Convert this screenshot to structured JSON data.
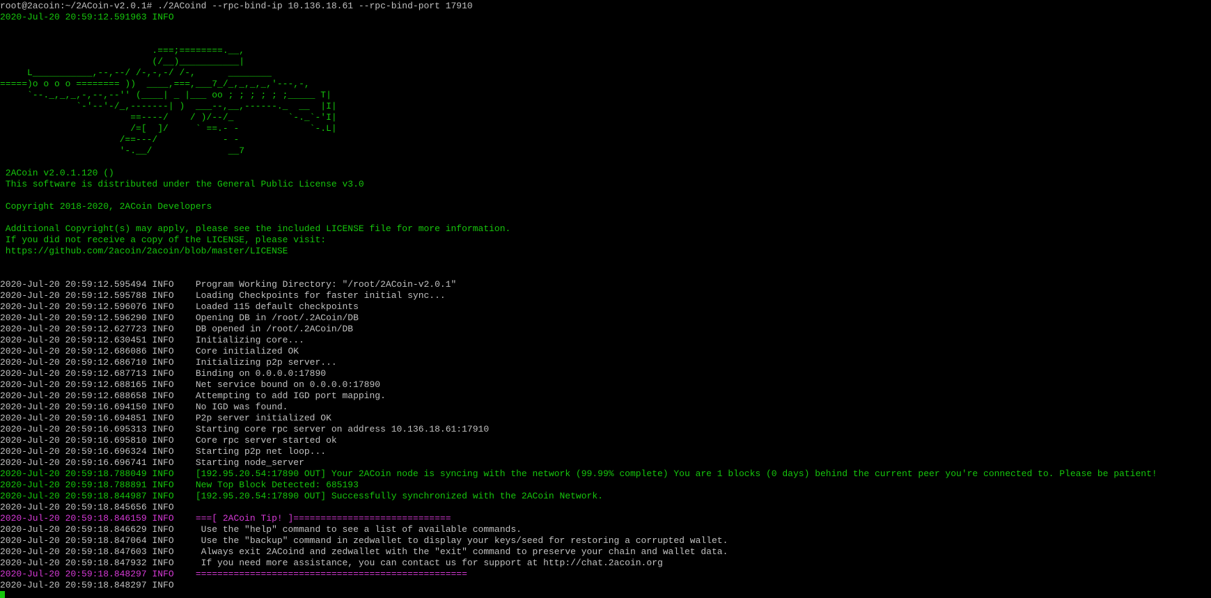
{
  "window": {
    "title": "root@2acoin:~/2ACoin-v2.0.1"
  },
  "colors": {
    "background": "#000000",
    "default_text": "#c0c0c0",
    "info_green": "#16c60c",
    "tip_magenta": "#d63ad6",
    "cursor": "#16c60c"
  },
  "terminal": {
    "lines": [
      {
        "text": "root@2acoin:~/2ACoin-v2.0.1# ./2ACoind --rpc-bind-ip 10.136.18.61 --rpc-bind-port 17910",
        "color": "white"
      },
      {
        "text": "2020-Jul-20 20:59:12.591963 INFO",
        "color": "green"
      },
      {
        "text": "",
        "color": "white"
      },
      {
        "text": "",
        "color": "white"
      },
      {
        "text": "                            .===;========.__,",
        "color": "green"
      },
      {
        "text": "                            (/__)___________|",
        "color": "green"
      },
      {
        "text": "     L___________,--,--/ /-,-,-/ /-,      ________",
        "color": "green"
      },
      {
        "text": "=====)o o o o ======== ))  ____,===,___7_/_,_,_,_,'---,-,",
        "color": "green"
      },
      {
        "text": "     `--._,_,_,-,--,--'' (____| _ |___ oo ; ; ; ; ; ;_____ T|",
        "color": "green"
      },
      {
        "text": "              `-'--'-/_,-------| )  ___--,__,------._  __  |I|",
        "color": "green"
      },
      {
        "text": "                        ==----/    / )/--/_          `-._`-'I|",
        "color": "green"
      },
      {
        "text": "                        /=[  ]/     ` ==.- -             `-.L|",
        "color": "green"
      },
      {
        "text": "                      /==---/            - -",
        "color": "green"
      },
      {
        "text": "                      '-.__/              __7",
        "color": "green"
      },
      {
        "text": "",
        "color": "white"
      },
      {
        "text": " 2ACoin v2.0.1.120 ()",
        "color": "green"
      },
      {
        "text": " This software is distributed under the General Public License v3.0",
        "color": "green"
      },
      {
        "text": "",
        "color": "white"
      },
      {
        "text": " Copyright 2018-2020, 2ACoin Developers",
        "color": "green"
      },
      {
        "text": "",
        "color": "white"
      },
      {
        "text": " Additional Copyright(s) may apply, please see the included LICENSE file for more information.",
        "color": "green"
      },
      {
        "text": " If you did not receive a copy of the LICENSE, please visit:",
        "color": "green"
      },
      {
        "text": " https://github.com/2acoin/2acoin/blob/master/LICENSE",
        "color": "green"
      },
      {
        "text": "",
        "color": "white"
      },
      {
        "text": "",
        "color": "white"
      },
      {
        "text": "2020-Jul-20 20:59:12.595494 INFO    Program Working Directory: \"/root/2ACoin-v2.0.1\"",
        "color": "white"
      },
      {
        "text": "2020-Jul-20 20:59:12.595788 INFO    Loading Checkpoints for faster initial sync...",
        "color": "white"
      },
      {
        "text": "2020-Jul-20 20:59:12.596076 INFO    Loaded 115 default checkpoints",
        "color": "white"
      },
      {
        "text": "2020-Jul-20 20:59:12.596290 INFO    Opening DB in /root/.2ACoin/DB",
        "color": "white"
      },
      {
        "text": "2020-Jul-20 20:59:12.627723 INFO    DB opened in /root/.2ACoin/DB",
        "color": "white"
      },
      {
        "text": "2020-Jul-20 20:59:12.630451 INFO    Initializing core...",
        "color": "white"
      },
      {
        "text": "2020-Jul-20 20:59:12.686086 INFO    Core initialized OK",
        "color": "white"
      },
      {
        "text": "2020-Jul-20 20:59:12.686710 INFO    Initializing p2p server...",
        "color": "white"
      },
      {
        "text": "2020-Jul-20 20:59:12.687713 INFO    Binding on 0.0.0.0:17890",
        "color": "white"
      },
      {
        "text": "2020-Jul-20 20:59:12.688165 INFO    Net service bound on 0.0.0.0:17890",
        "color": "white"
      },
      {
        "text": "2020-Jul-20 20:59:12.688658 INFO    Attempting to add IGD port mapping.",
        "color": "white"
      },
      {
        "text": "2020-Jul-20 20:59:16.694150 INFO    No IGD was found.",
        "color": "white"
      },
      {
        "text": "2020-Jul-20 20:59:16.694851 INFO    P2p server initialized OK",
        "color": "white"
      },
      {
        "text": "2020-Jul-20 20:59:16.695313 INFO    Starting core rpc server on address 10.136.18.61:17910",
        "color": "white"
      },
      {
        "text": "2020-Jul-20 20:59:16.695810 INFO    Core rpc server started ok",
        "color": "white"
      },
      {
        "text": "2020-Jul-20 20:59:16.696324 INFO    Starting p2p net loop...",
        "color": "white"
      },
      {
        "text": "2020-Jul-20 20:59:16.696741 INFO    Starting node_server",
        "color": "white"
      },
      {
        "text": "2020-Jul-20 20:59:18.788049 INFO    [192.95.20.54:17890 OUT] Your 2ACoin node is syncing with the network (99.99% complete) You are 1 blocks (0 days) behind the current peer you're connected to. Please be patient!",
        "color": "green"
      },
      {
        "text": "2020-Jul-20 20:59:18.788891 INFO    New Top Block Detected: 685193",
        "color": "green"
      },
      {
        "text": "2020-Jul-20 20:59:18.844987 INFO    [192.95.20.54:17890 OUT] Successfully synchronized with the 2ACoin Network.",
        "color": "green"
      },
      {
        "text": "2020-Jul-20 20:59:18.845656 INFO",
        "color": "white"
      },
      {
        "text": "2020-Jul-20 20:59:18.846159 INFO    ===[ 2ACoin Tip! ]=============================",
        "color": "magenta"
      },
      {
        "text": "2020-Jul-20 20:59:18.846629 INFO     Use the \"help\" command to see a list of available commands.",
        "color": "white"
      },
      {
        "text": "2020-Jul-20 20:59:18.847064 INFO     Use the \"backup\" command in zedwallet to display your keys/seed for restoring a corrupted wallet.",
        "color": "white"
      },
      {
        "text": "2020-Jul-20 20:59:18.847603 INFO     Always exit 2ACoind and zedwallet with the \"exit\" command to preserve your chain and wallet data.",
        "color": "white"
      },
      {
        "text": "2020-Jul-20 20:59:18.847932 INFO     If you need more assistance, you can contact us for support at http://chat.2acoin.org",
        "color": "white"
      },
      {
        "text": "2020-Jul-20 20:59:18.848297 INFO    ==================================================",
        "color": "magenta"
      },
      {
        "text": "2020-Jul-20 20:59:18.848297 INFO",
        "color": "white"
      }
    ]
  }
}
